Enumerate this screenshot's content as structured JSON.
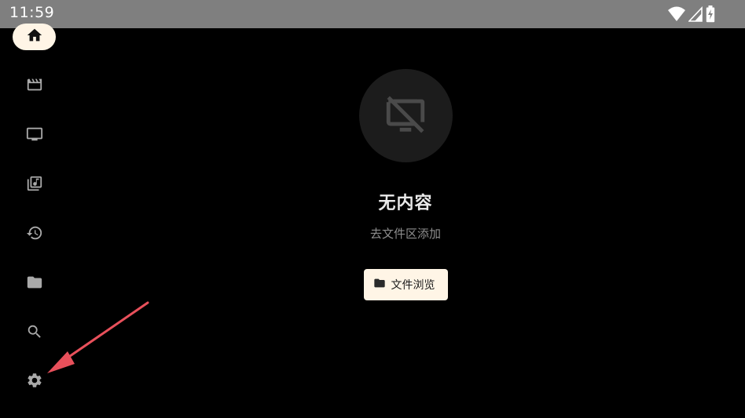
{
  "status_bar": {
    "time": "11:59"
  },
  "sidebar": {
    "items": [
      {
        "icon": "home-icon",
        "active": true
      },
      {
        "icon": "movie-icon",
        "active": false
      },
      {
        "icon": "tv-icon",
        "active": false
      },
      {
        "icon": "music-library-icon",
        "active": false
      },
      {
        "icon": "history-icon",
        "active": false
      },
      {
        "icon": "folder-icon",
        "active": false
      },
      {
        "icon": "search-icon",
        "active": false
      },
      {
        "icon": "gear-icon",
        "active": false
      }
    ]
  },
  "empty_state": {
    "icon": "no-display-icon",
    "title": "无内容",
    "subtitle": "去文件区添加",
    "button_label": "文件浏览",
    "button_icon": "folder-icon"
  },
  "colors": {
    "status_bar_bg": "#7f7f7f",
    "accent_cream": "#fff5e6",
    "icon_gray": "#a9a9a9",
    "annotation_red": "#e8505b"
  }
}
